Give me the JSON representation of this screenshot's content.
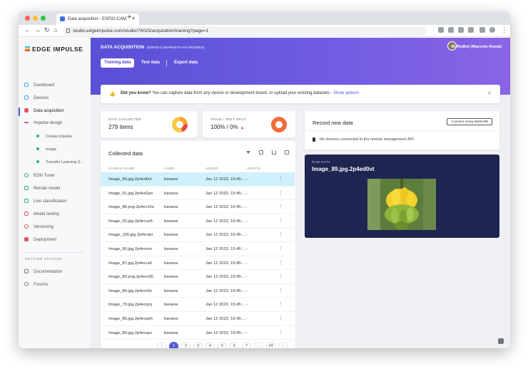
{
  "browser": {
    "tab_title": "Data acquisition - ESP32-CAM",
    "url": "studio.edgeimpulse.com/studio/76025/acquisition/training?page=1"
  },
  "sidebar": {
    "brand": "EDGE IMPULSE",
    "items": [
      {
        "label": "Dashboard"
      },
      {
        "label": "Devices"
      },
      {
        "label": "Data acquisition"
      },
      {
        "label": "Impulse design"
      },
      {
        "label": "Create impulse"
      },
      {
        "label": "Image"
      },
      {
        "label": "Transfer Learning (I..."
      },
      {
        "label": "EON Tuner"
      },
      {
        "label": "Retrain model"
      },
      {
        "label": "Live classification"
      },
      {
        "label": "Model testing"
      },
      {
        "label": "Versioning"
      },
      {
        "label": "Deployment"
      }
    ],
    "getting_started": "GETTING STARTED",
    "help_items": [
      {
        "label": "Documentation"
      },
      {
        "label": "Forums"
      }
    ]
  },
  "header": {
    "title": "DATA ACQUISITION",
    "project": "(ESP32-CAM-FRUITS-VS-VEGGIES)",
    "user": "MJRoBot (Marcelo Rovai)",
    "tabs": [
      {
        "label": "Training data"
      },
      {
        "label": "Test data"
      },
      {
        "label": "Export data"
      }
    ]
  },
  "banner": {
    "lead": "Did you know?",
    "text": "You can capture data from any device or development board, or upload your existing datasets -",
    "link": "Show options"
  },
  "stats": {
    "collected_label": "DATA COLLECTED",
    "collected_value": "279 items",
    "split_label": "TRAIN / TEST SPLIT",
    "split_value": "100% / 0%"
  },
  "collected": {
    "title": "Collected data",
    "columns": [
      "SAMPLE NAME",
      "LABEL",
      "ADDED",
      "LENGTH"
    ],
    "rows": [
      {
        "name": "Image_89.jpg.2p4ed0vt",
        "label": "banana",
        "added": "Jan 12 2022, 15:45:...",
        "length": "-"
      },
      {
        "name": "Image_91.jpg.2p4ed1po",
        "label": "banana",
        "added": "Jan 12 2022, 15:45:...",
        "length": "-"
      },
      {
        "name": "Image_88.png.2p4ecv5e",
        "label": "banana",
        "added": "Jan 12 2022, 15:45:...",
        "length": "-"
      },
      {
        "name": "Image_92.jpg.2p4ecus5",
        "label": "banana",
        "added": "Jan 12 2022, 15:45:...",
        "length": "-"
      },
      {
        "name": "Image_100.jpg.2p4ectpi",
        "label": "banana",
        "added": "Jan 12 2022, 15:45:...",
        "length": "-"
      },
      {
        "name": "Image_90.jpg.2p4ecsnc",
        "label": "banana",
        "added": "Jan 12 2022, 15:45:...",
        "length": "-"
      },
      {
        "name": "Image_87.jpg.2p4ecra6",
        "label": "banana",
        "added": "Jan 12 2022, 15:45:...",
        "length": "-"
      },
      {
        "name": "Image_83.png.2p4ecr56",
        "label": "banana",
        "added": "Jan 12 2022, 15:45:...",
        "length": "-"
      },
      {
        "name": "Image_84.jpg.2p4ecr6e",
        "label": "banana",
        "added": "Jan 12 2022, 15:45:...",
        "length": "-"
      },
      {
        "name": "Image_79.jpg.2p4ecqrq",
        "label": "banana",
        "added": "Jan 12 2022, 15:45:...",
        "length": "-"
      },
      {
        "name": "Image_86.jpg.2p4ecqsh",
        "label": "banana",
        "added": "Jan 12 2022, 15:45:...",
        "length": "-"
      },
      {
        "name": "Image_85.jpg.2p4ecqsc",
        "label": "banana",
        "added": "Jan 12 2022, 15:45:...",
        "length": "-"
      }
    ]
  },
  "pagination": {
    "prev": "‹",
    "pages": [
      "1",
      "2",
      "3",
      "4",
      "5",
      "6",
      "7",
      "...",
      "24"
    ],
    "next": "›",
    "current": "1"
  },
  "record": {
    "title": "Record new data",
    "connect": "Connect using WebUSB",
    "status": "No devices connected to the remote management API."
  },
  "raw": {
    "label": "RAW DATA",
    "name": "Image_89.jpg.2p4ed0vt"
  },
  "colors": {
    "accent": "#4f5bd5",
    "header_from": "#5a4fd6",
    "header_to": "#8a64e6",
    "selected_row": "#cff1fb",
    "raw_bg": "#1e2550"
  }
}
